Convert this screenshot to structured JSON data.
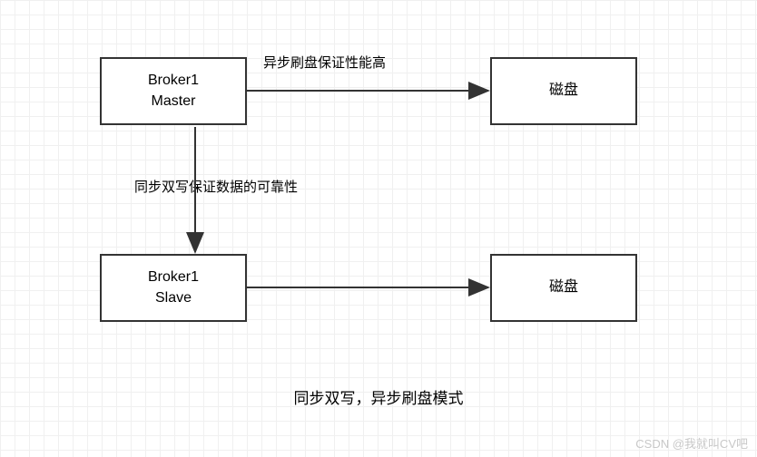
{
  "nodes": {
    "master": {
      "line1": "Broker1",
      "line2": "Master"
    },
    "disk1": {
      "label": "磁盘"
    },
    "slave": {
      "line1": "Broker1",
      "line2": "Slave"
    },
    "disk2": {
      "label": "磁盘"
    }
  },
  "edges": {
    "async_label": "异步刷盘保证性能高",
    "sync_label": "同步双写保证数据的可靠性"
  },
  "caption": "同步双写，异步刷盘模式",
  "watermark": "CSDN @我就叫CV吧"
}
